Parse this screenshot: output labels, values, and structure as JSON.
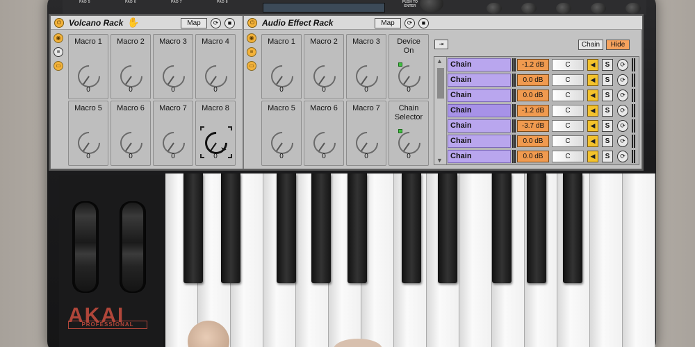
{
  "hardware": {
    "pad_labels": [
      "PAD 5",
      "PAD 6",
      "PAD 7",
      "PAD 8"
    ],
    "push_label": "PUSH\nTO ENTER",
    "logo": "AKAI",
    "logo_sub": "PROFESSIONAL"
  },
  "volcano_rack": {
    "title": "Volcano Rack",
    "map_label": "Map",
    "macros": [
      {
        "label": "Macro 1",
        "value": "0"
      },
      {
        "label": "Macro 2",
        "value": "0"
      },
      {
        "label": "Macro 3",
        "value": "0"
      },
      {
        "label": "Macro 4",
        "value": "0"
      },
      {
        "label": "Macro 5",
        "value": "0"
      },
      {
        "label": "Macro 6",
        "value": "0"
      },
      {
        "label": "Macro 7",
        "value": "0"
      },
      {
        "label": "Macro 8",
        "value": "0"
      }
    ]
  },
  "audio_effect_rack": {
    "title": "Audio Effect Rack",
    "map_label": "Map",
    "macros": [
      {
        "label": "Macro 1",
        "value": "0"
      },
      {
        "label": "Macro 2",
        "value": "0"
      },
      {
        "label": "Macro 3",
        "value": "0"
      },
      {
        "label": "Device On",
        "value": "0"
      },
      {
        "label": "Macro 5",
        "value": "0"
      },
      {
        "label": "Macro 6",
        "value": "0"
      },
      {
        "label": "Macro 7",
        "value": "0"
      },
      {
        "label": "Chain Selector",
        "value": "0"
      }
    ],
    "chain_button": "Chain",
    "hide_button": "Hide",
    "chains": [
      {
        "name": "Chain",
        "volume": "-1.2 dB",
        "pan": "C",
        "solo": "S"
      },
      {
        "name": "Chain",
        "volume": "0.0 dB",
        "pan": "C",
        "solo": "S"
      },
      {
        "name": "Chain",
        "volume": "0.0 dB",
        "pan": "C",
        "solo": "S"
      },
      {
        "name": "Chain",
        "volume": "-1.2 dB",
        "pan": "C",
        "solo": "S"
      },
      {
        "name": "Chain",
        "volume": "-3.7 dB",
        "pan": "C",
        "solo": "S"
      },
      {
        "name": "Chain",
        "volume": "0.0 dB",
        "pan": "C",
        "solo": "S"
      },
      {
        "name": "Chain",
        "volume": "0.0 dB",
        "pan": "C",
        "solo": "S"
      }
    ]
  },
  "colors": {
    "accent_orange": "#f09a4f",
    "chain_purple": "#b9a6ee",
    "power_yellow": "#f3b23a",
    "hide_orange": "#f5a25d"
  }
}
